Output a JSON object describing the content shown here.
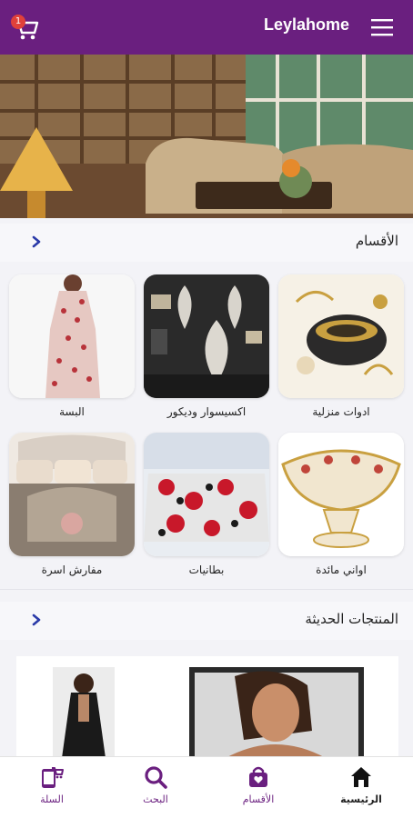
{
  "header": {
    "title": "Leylahome",
    "cart_count": "1",
    "bg_color": "#6a1f7f"
  },
  "categories_section": {
    "title": "الأقسام",
    "items": [
      {
        "label": "ادوات منزلية"
      },
      {
        "label": "اكسيسوار وديكور"
      },
      {
        "label": "البسة"
      },
      {
        "label": "اواني مائدة"
      },
      {
        "label": "بطانيات"
      },
      {
        "label": "مفارش اسرة"
      }
    ]
  },
  "products_section": {
    "title": "المنتجات الحديثة"
  },
  "bottom_nav": {
    "items": [
      {
        "label": "الرئيسية",
        "icon": "home-icon",
        "active": true
      },
      {
        "label": "الأقسام",
        "icon": "shopping-bag-icon"
      },
      {
        "label": "البحث",
        "icon": "search-icon"
      },
      {
        "label": "السلة",
        "icon": "phone-cart-icon"
      }
    ]
  },
  "colors": {
    "brand": "#6a1f7f",
    "badge": "#e0413a",
    "background": "#f3f3f7"
  }
}
